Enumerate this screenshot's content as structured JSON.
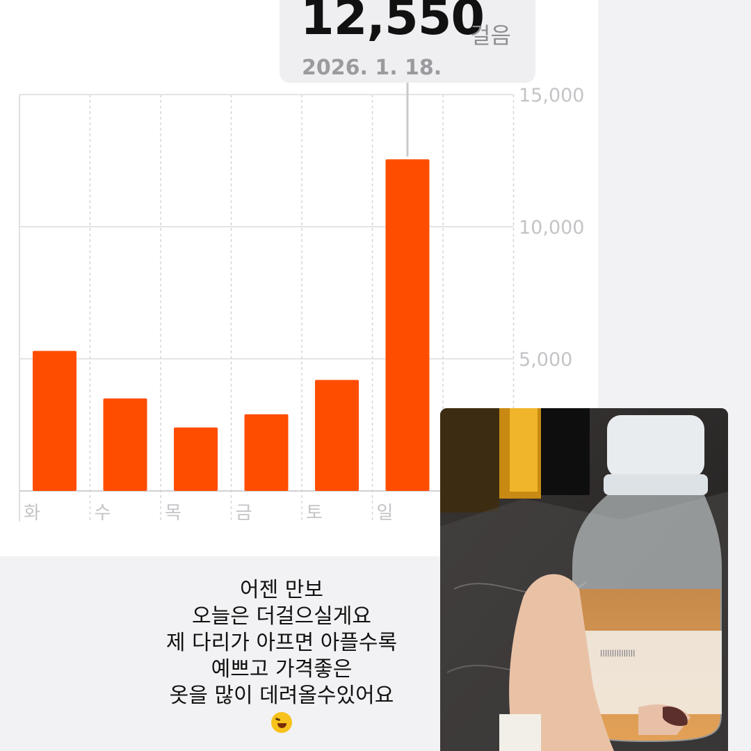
{
  "tooltip": {
    "value": "12,550",
    "unit": "걸음",
    "date": "2026. 1. 18."
  },
  "chart_data": {
    "type": "bar",
    "title": "",
    "xlabel": "",
    "ylabel": "",
    "categories": [
      "화",
      "수",
      "목",
      "금",
      "토",
      "일"
    ],
    "values": [
      5300,
      3500,
      2400,
      2900,
      4200,
      12550
    ],
    "ylim": [
      0,
      15000
    ],
    "yticks": [
      5000,
      10000,
      15000
    ],
    "ytick_labels": [
      "5,000",
      "10,000",
      "15,000"
    ],
    "highlighted_index": 5,
    "grid": true,
    "bar_color": "#ff4d00",
    "axis_position": "right"
  },
  "caption": {
    "lines": [
      "어젠 만보",
      "오늘은 더걸으실게요",
      "제 다리가 아프면 아플수록",
      "예쁘고 가격좋은",
      "옷을 많이 데려올수있어요"
    ],
    "emoji": "rolling-on-floor-laughing-emoji"
  },
  "photo": {
    "subject": "hand holding a bottle of orange drink"
  },
  "colors": {
    "bar": "#ff4d00",
    "grid": "#dcdcdf",
    "tick_text": "#c4c4c8",
    "background": "#f2f2f4"
  }
}
